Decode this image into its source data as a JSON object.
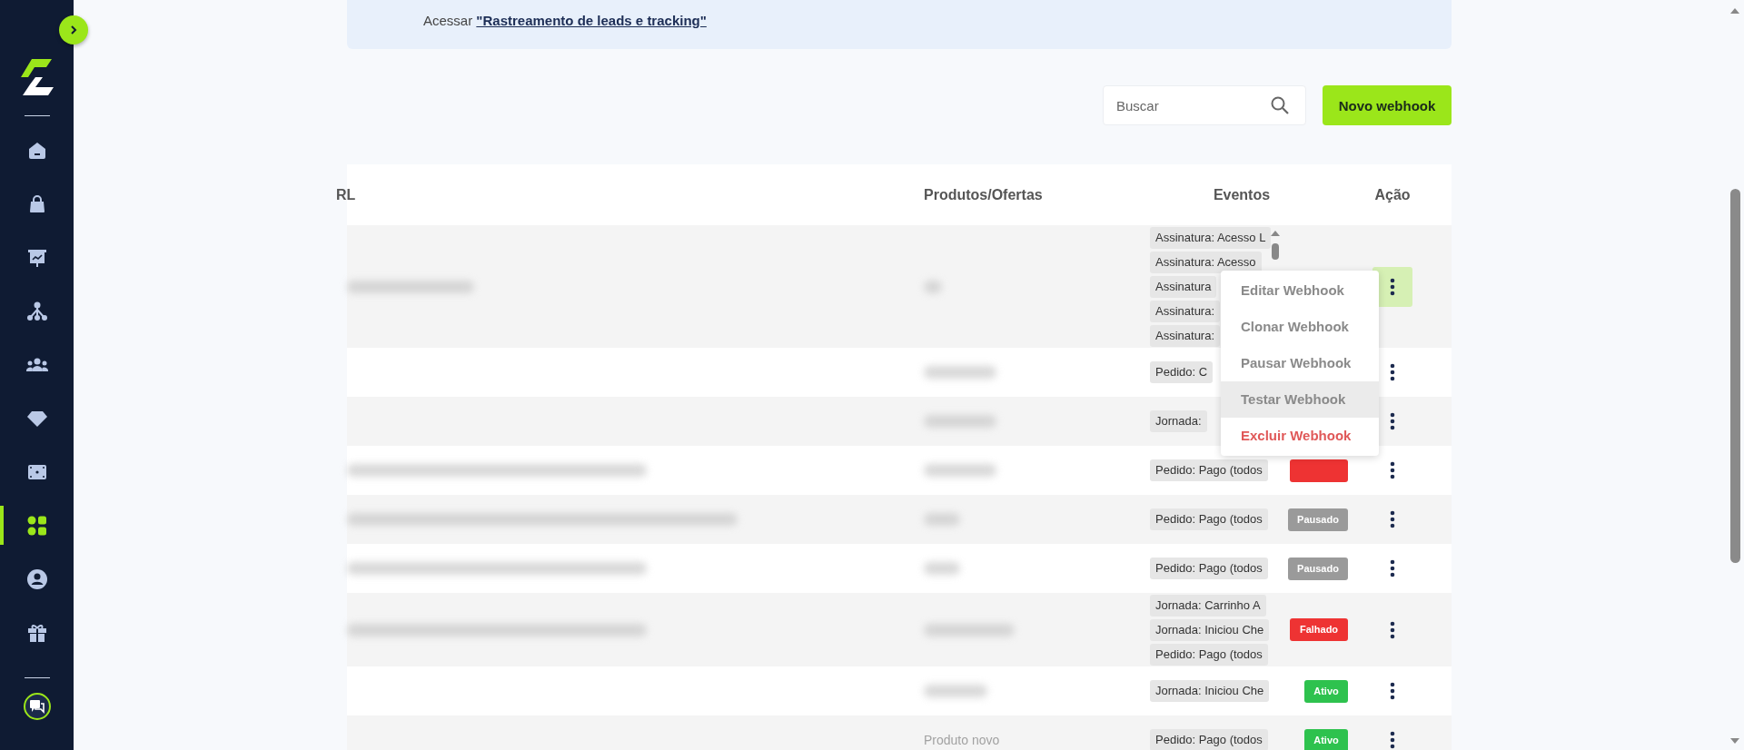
{
  "sidebar": {
    "items": [
      {
        "kind": "home",
        "selected": false
      },
      {
        "kind": "bag",
        "selected": false
      },
      {
        "kind": "board",
        "selected": false
      },
      {
        "kind": "network",
        "selected": false
      },
      {
        "kind": "people",
        "selected": false
      },
      {
        "kind": "diamond",
        "selected": false
      },
      {
        "kind": "ticket",
        "selected": false
      },
      {
        "kind": "grid",
        "selected": true
      },
      {
        "kind": "user",
        "selected": false
      },
      {
        "kind": "gift",
        "selected": false
      }
    ]
  },
  "banner": {
    "prefix": "Acessar",
    "link": "\"Rastreamento de leads e tracking\""
  },
  "search": {
    "placeholder": "Buscar"
  },
  "new_button": "Novo webhook",
  "table": {
    "columns": [
      "RL",
      "Produtos/Ofertas",
      "Eventos",
      "Ação"
    ],
    "rows": [
      {
        "events": [
          "Assinatura: Acesso L",
          "Assinatura: Acesso",
          "Assinatura",
          "Assinatura:",
          "Assinatura:"
        ],
        "menu_open": true
      },
      {
        "events": [
          "Pedido: C"
        ],
        "menu_open": false
      },
      {
        "events": [
          "Jornada:"
        ],
        "menu_open": false
      },
      {
        "events": [
          "Pedido: Pago (todos"
        ],
        "status": {
          "kind": "failed"
        },
        "menu_open": false
      },
      {
        "events": [
          "Pedido: Pago (todos"
        ],
        "status": {
          "kind": "paused",
          "label": "Pausado"
        },
        "menu_open": false
      },
      {
        "events": [
          "Pedido: Pago (todos"
        ],
        "status": {
          "kind": "paused",
          "label": "Pausado"
        },
        "menu_open": false
      },
      {
        "events": [
          "Jornada: Carrinho A",
          "Jornada: Iniciou Che",
          "Pedido: Pago (todos"
        ],
        "status": {
          "kind": "failed",
          "label": "Falhado"
        },
        "menu_open": false
      },
      {
        "events": [
          "Jornada: Iniciou Che"
        ],
        "status": {
          "kind": "active",
          "label": "Ativo"
        },
        "menu_open": false
      },
      {
        "product": "Produto novo",
        "events": [
          "Pedido: Pago (todos"
        ],
        "status": {
          "kind": "active",
          "label": "Ativo"
        },
        "menu_open": false
      }
    ]
  },
  "row_menu": {
    "items": [
      {
        "label": "Editar Webhook",
        "kind": "normal",
        "selected": false
      },
      {
        "label": "Clonar Webhook",
        "kind": "normal",
        "selected": false
      },
      {
        "label": "Pausar Webhook",
        "kind": "normal",
        "selected": false
      },
      {
        "label": "Testar Webhook",
        "kind": "normal",
        "selected": true
      },
      {
        "label": "Excluir Webhook",
        "kind": "danger",
        "selected": false
      }
    ]
  }
}
